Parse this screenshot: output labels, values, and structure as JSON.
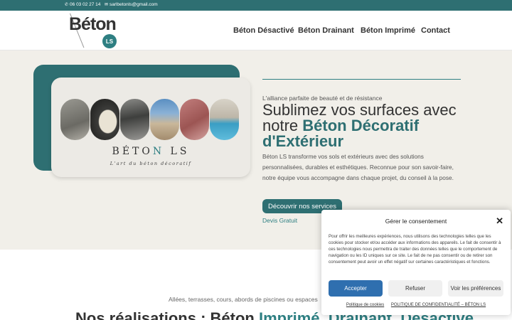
{
  "topbar": {
    "phone": "06 03 02 27 14",
    "email": "sarlbetonls@gmail.com",
    "phone_icon": "phone-icon",
    "email_icon": "envelope-icon"
  },
  "logo": {
    "wordmark": "Béton",
    "badge": "LS"
  },
  "nav": {
    "items": [
      {
        "label": "Béton Désactivé"
      },
      {
        "label": "Béton Drainant"
      },
      {
        "label": "Béton Imprimé"
      },
      {
        "label": "Contact"
      }
    ]
  },
  "hero": {
    "brand_pre": "BÉTO",
    "brand_n": "N",
    "brand_post": " LS",
    "brand_tagline": "L'art du béton décoratif",
    "kicker": "L'alliance parfaite de beauté et de résistance",
    "headline_plain": "Sublimez vos surfaces avec notre ",
    "headline_accent": "Béton Décoratif d'Extérieur",
    "paragraph": "Béton LS transforme vos sols et extérieurs avec des solutions personnalisées, durables et esthétiques. Reconnue pour son savoir-faire, notre équipe vous accompagne dans chaque projet, du conseil à la pose.",
    "cta_label": "Découvrir nos services",
    "secondary_link": "Devis Gratuit"
  },
  "section2": {
    "subtitle": "Allées, terrasses, cours, abords de piscines ou espaces",
    "title_plain": "Nos réalisations : Béton ",
    "title_accent": "Imprimé, Drainant, Désactivé"
  },
  "cookie": {
    "title": "Gérer le consentement",
    "body": "Pour offrir les meilleures expériences, nous utilisons des technologies telles que les cookies pour stocker et/ou accéder aux informations des appareils. Le fait de consentir à ces technologies nous permettra de traiter des données telles que le comportement de navigation ou les ID uniques sur ce site. Le fait de ne pas consentir ou de retirer son consentement peut avoir un effet négatif sur certaines caractéristiques et fonctions.",
    "accept": "Accepter",
    "refuse": "Refuser",
    "preferences": "Voir les préférences",
    "link_cookies": "Politique de cookies",
    "link_privacy": "POLITIQUE DE CONFIDENTIALITÉ – BÉTON LS",
    "colors": {
      "accent": "#2f6faf"
    }
  },
  "colors": {
    "teal": "#2e6f72",
    "teal_light": "#2e7f82",
    "background": "#f1efe9"
  }
}
